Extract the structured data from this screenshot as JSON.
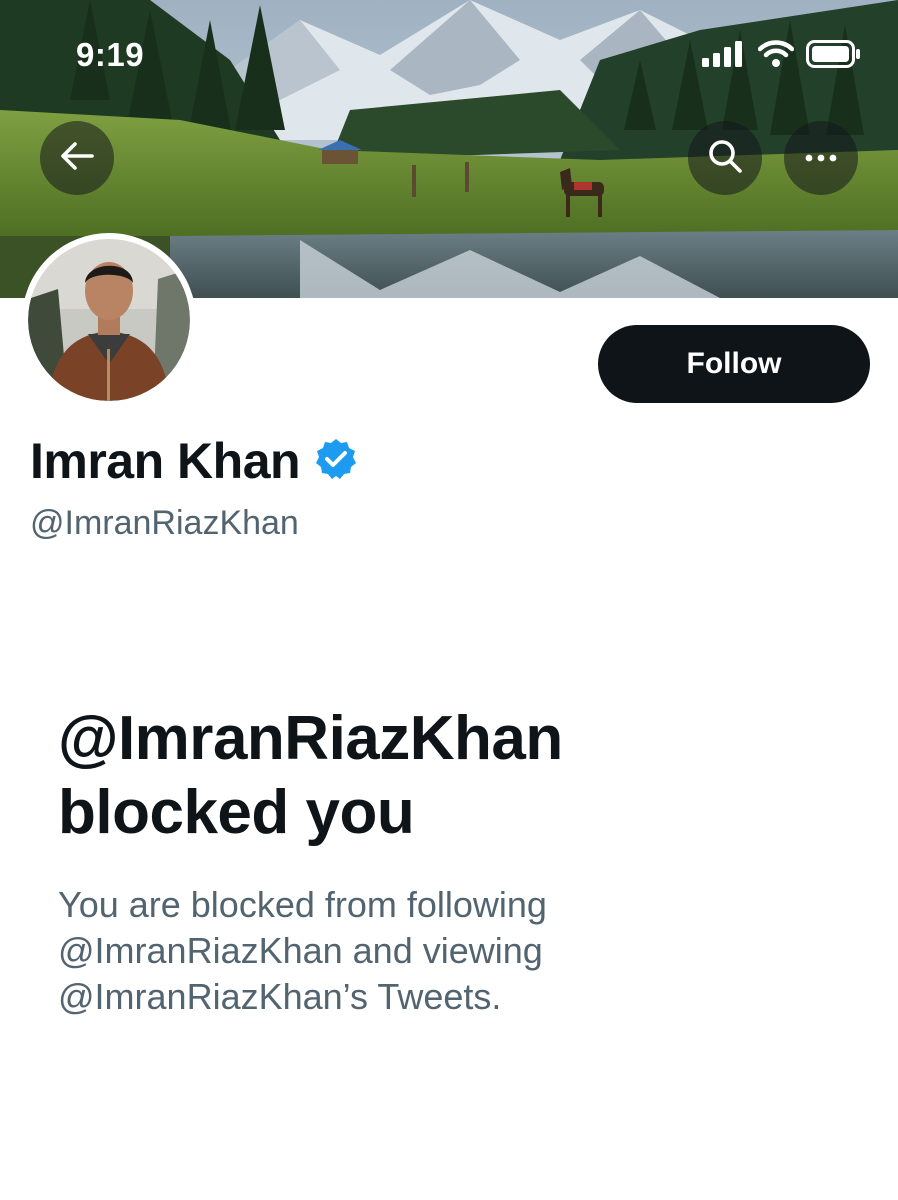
{
  "status_bar": {
    "time": "9:19"
  },
  "icons": {
    "back": "arrow-left-icon",
    "search": "search-icon",
    "more": "more-horizontal-icon",
    "verified": "verified-badge-icon",
    "signal": "cellular-signal-icon",
    "wifi": "wifi-icon",
    "battery": "battery-icon"
  },
  "profile": {
    "display_name": "Imran Khan",
    "handle": "@ImranRiazKhan",
    "verified": true,
    "follow_label": "Follow"
  },
  "blocked": {
    "title_line1": "@ImranRiazKhan",
    "title_line2": "blocked you",
    "body_line1": "You are blocked from following",
    "body_line2": "@ImranRiazKhan and viewing",
    "body_line3": "@ImranRiazKhan’s Tweets."
  },
  "colors": {
    "primary_text": "#0f1419",
    "secondary_text": "#536471",
    "verified_blue": "#1d9bf0",
    "follow_bg": "#0f1419"
  }
}
